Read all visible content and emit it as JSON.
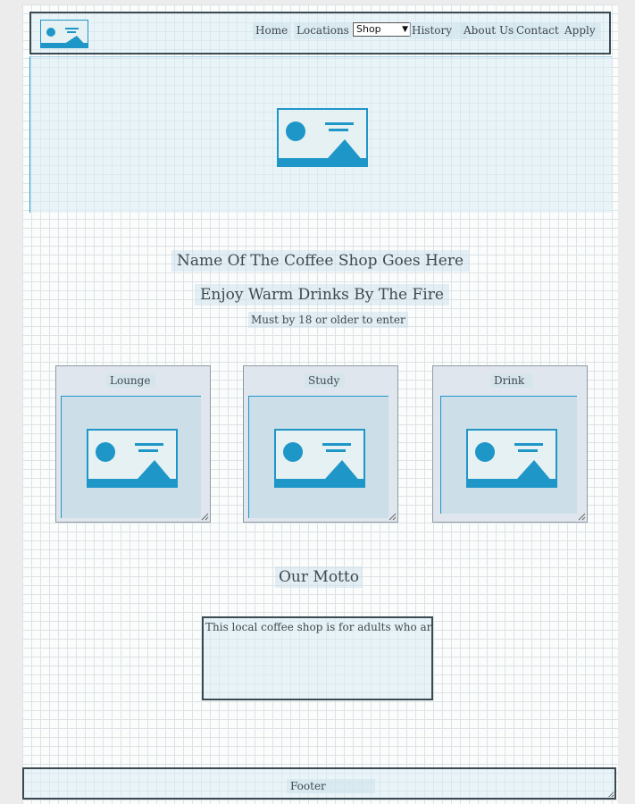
{
  "header": {
    "logo_icon": "image-placeholder-icon",
    "nav": {
      "home": "Home",
      "locations": "Locations",
      "shop_selected": "Shop",
      "history": "History",
      "about": "About Us",
      "contact": "Contact",
      "apply": "Apply"
    }
  },
  "hero": {
    "image_icon": "image-placeholder-icon"
  },
  "intro": {
    "title": "Name Of The Coffee Shop Goes Here",
    "subtitle": "Enjoy Warm Drinks By The Fire",
    "note": "Must by 18 or older to enter"
  },
  "cards": [
    {
      "label": "Lounge",
      "image_icon": "image-placeholder-icon"
    },
    {
      "label": "Study",
      "image_icon": "image-placeholder-icon"
    },
    {
      "label": "Drink",
      "image_icon": "image-placeholder-icon"
    }
  ],
  "motto": {
    "title": "Our Motto",
    "text": "This local coffee shop is for adults who are seekin"
  },
  "footer": {
    "label": "Footer"
  },
  "colors": {
    "accent": "#1e96c8",
    "border": "#3a4a52",
    "panel": "#dbecf4",
    "card": "#dfe6ee"
  }
}
